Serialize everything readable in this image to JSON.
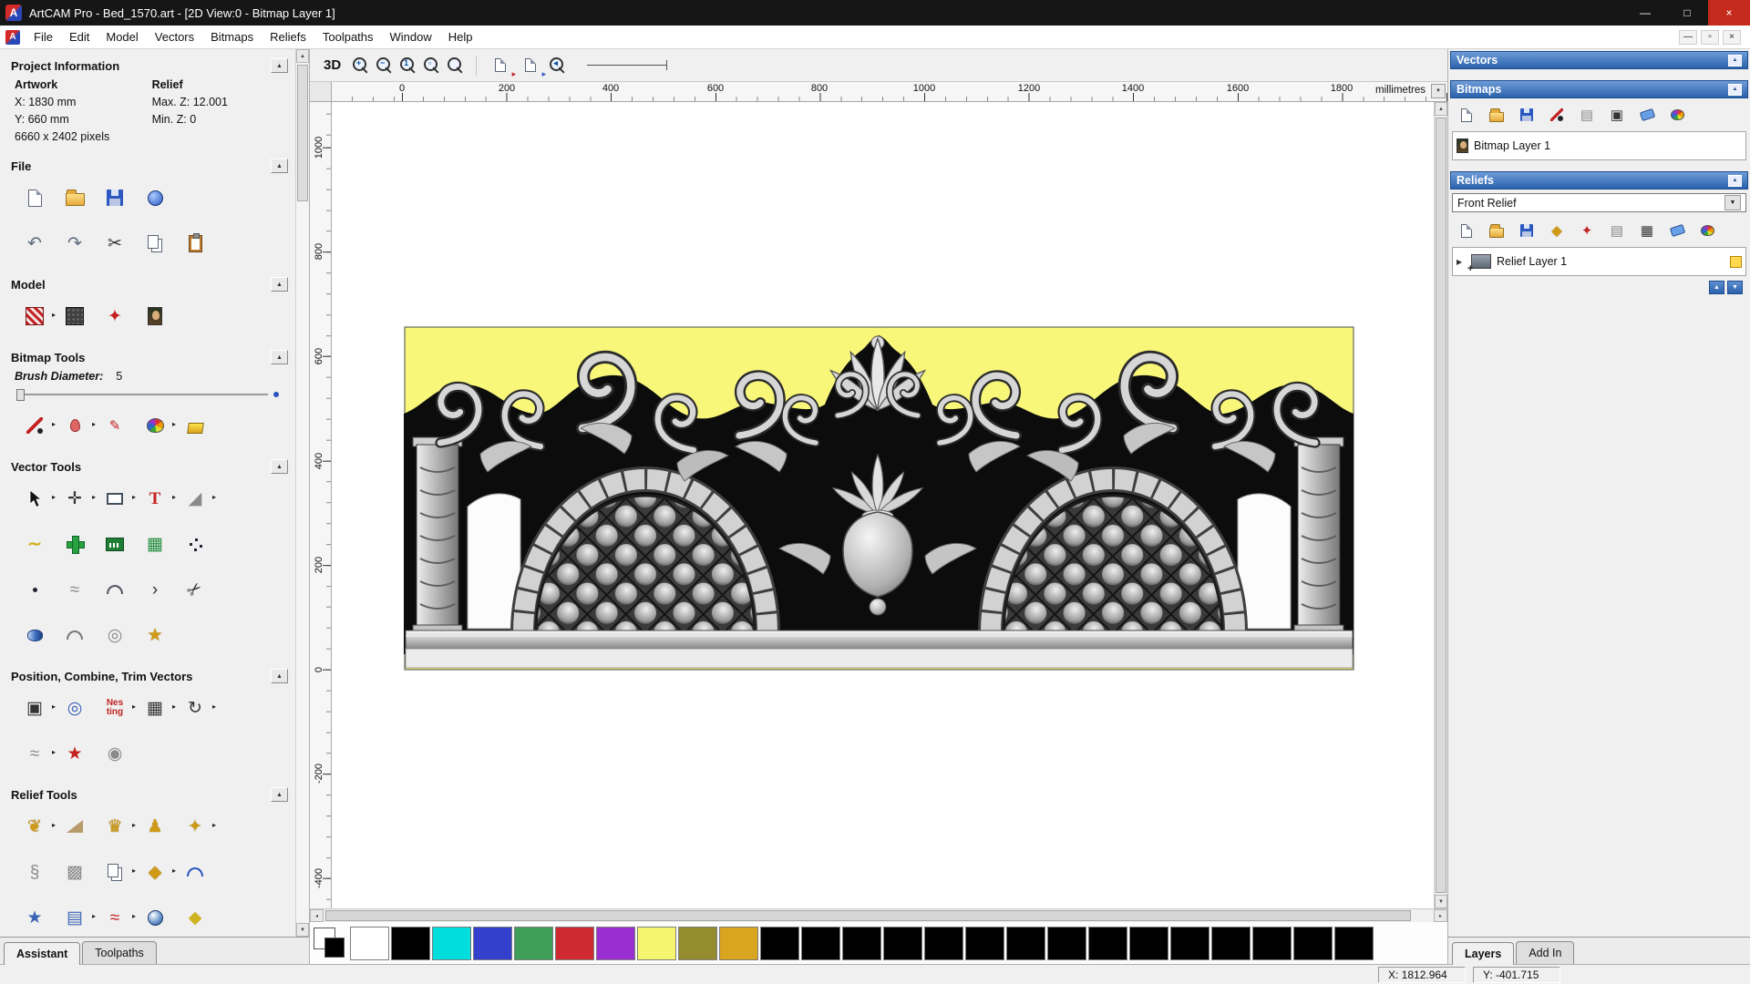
{
  "window": {
    "title": "ArtCAM Pro - Bed_1570.art - [2D View:0 - Bitmap Layer 1]"
  },
  "menubar": {
    "items": [
      "File",
      "Edit",
      "Model",
      "Vectors",
      "Bitmaps",
      "Reliefs",
      "Toolpaths",
      "Window",
      "Help"
    ]
  },
  "left_panel": {
    "project_information": {
      "title": "Project Information",
      "artwork_label": "Artwork",
      "relief_label": "Relief",
      "x_value": "X: 1830 mm",
      "y_value": "Y: 660 mm",
      "pixels": "6660 x 2402 pixels",
      "max_z": "Max. Z: 12.001",
      "min_z": "Min. Z: 0"
    },
    "file_title": "File",
    "model_title": "Model",
    "bitmap_tools_title": "Bitmap Tools",
    "brush_diameter_label": "Brush Diameter:",
    "brush_diameter_value": "5",
    "vector_tools_title": "Vector Tools",
    "position_title": "Position, Combine, Trim Vectors",
    "relief_tools_title": "Relief Tools",
    "nesting_icon_text": "Nes ting",
    "tabs": [
      "Assistant",
      "Toolpaths"
    ]
  },
  "toolbar": {
    "view_3d": "3D"
  },
  "ruler": {
    "unit": "millimetres",
    "h_ticks": [
      "0",
      "200",
      "400",
      "600",
      "800",
      "1000",
      "1200",
      "1400",
      "1600",
      "1800"
    ],
    "v_ticks": [
      "1000",
      "800",
      "600",
      "400",
      "200",
      "0",
      "-200",
      "-400"
    ]
  },
  "right_panel": {
    "vectors_title": "Vectors",
    "bitmaps_title": "Bitmaps",
    "bitmap_layer_name": "Bitmap Layer 1",
    "reliefs_title": "Reliefs",
    "relief_selector_value": "Front Relief",
    "relief_layer_name": "Relief Layer 1",
    "tabs": [
      "Layers",
      "Add In"
    ]
  },
  "palette": {
    "colors": [
      "#ffffff",
      "#000000",
      "#00dddd",
      "#3340cc",
      "#3f9e58",
      "#cf2931",
      "#9a2fd1",
      "#f5f570",
      "#948c2e",
      "#d9a41e",
      "#000000",
      "#000000",
      "#000000",
      "#000000",
      "#000000",
      "#000000",
      "#000000",
      "#000000",
      "#000000",
      "#000000",
      "#000000",
      "#000000",
      "#000000",
      "#000000",
      "#000000"
    ]
  },
  "statusbar": {
    "x_readout": "X: 1812.964",
    "y_readout": "Y: -401.715"
  },
  "glyphs": {
    "collapse_up": "▲",
    "flyout": "▸",
    "combo_down": "▼",
    "scroll_up": "▲",
    "scroll_down": "▼",
    "layer_up": "▲",
    "layer_down": "▼",
    "expander": "▶",
    "minimize": "—",
    "maximize": "□",
    "close": "×",
    "mdi_minimize": "—",
    "mdi_restore": "▫",
    "mdi_close": "×",
    "unit_stepper": "▼",
    "plus_badge": "+"
  }
}
